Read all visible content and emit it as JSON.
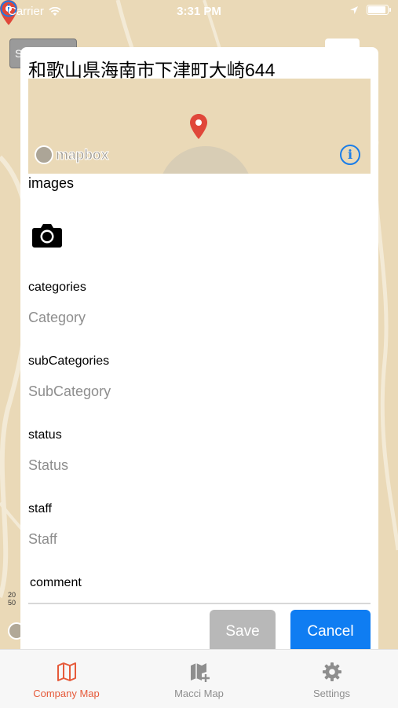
{
  "status_bar": {
    "carrier": "Carrier",
    "time": "3:31 PM"
  },
  "modal": {
    "address": "和歌山県海南市下津町大崎644",
    "map_attribution": "mapbox",
    "sections": {
      "images_label": "images",
      "categories_label": "categories",
      "categories_placeholder": "Category",
      "subcategories_label": "subCategories",
      "subcategories_placeholder": "SubCategory",
      "status_label": "status",
      "status_placeholder": "Status",
      "staff_label": "staff",
      "staff_placeholder": "Staff",
      "comment_label": "comment"
    },
    "buttons": {
      "save": "Save",
      "cancel": "Cancel"
    }
  },
  "tab_bar": {
    "tabs": [
      {
        "label": "Company Map",
        "icon": "map-icon",
        "active": true
      },
      {
        "label": "Macci Map",
        "icon": "map-add-icon",
        "active": false
      },
      {
        "label": "Settings",
        "icon": "gear-icon",
        "active": false
      }
    ]
  },
  "colors": {
    "accent": "#e65a3a",
    "primary_button": "#0f7df2",
    "disabled_button": "#b8b8b8",
    "map_land": "#ead9b7",
    "pin": "#e0473a"
  }
}
